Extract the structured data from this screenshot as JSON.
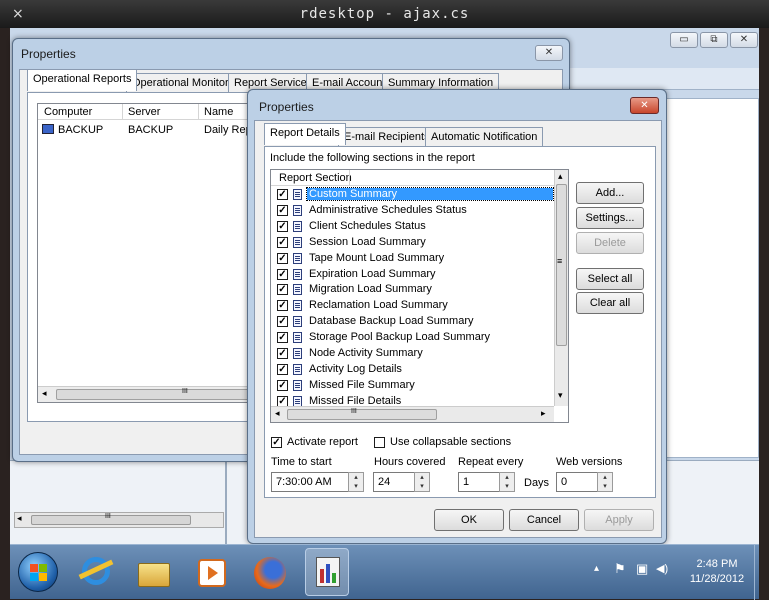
{
  "rdesktop": {
    "title": "rdesktop - ajax.cs",
    "close_glyph": "×"
  },
  "background_app": {
    "minimize": "▭",
    "maximize": "⧉",
    "close": "✕",
    "scroll_left": "◂",
    "scroll_grip": "III"
  },
  "properties_back": {
    "title": "Properties",
    "close": "✕",
    "tabs": [
      "Operational Reports",
      "Operational Monitors",
      "Report Service",
      "E-mail Account",
      "Summary Information"
    ],
    "columns": [
      "Computer",
      "Server",
      "Name"
    ],
    "rows": [
      {
        "computer": "BACKUP",
        "server": "BACKUP",
        "name": "Daily Rep"
      }
    ],
    "scroll_left": "◂",
    "scroll_grip": "III"
  },
  "properties_front": {
    "title": "Properties",
    "close": "✕",
    "tabs": [
      "Report Details",
      "E-mail Recipients",
      "Automatic Notification"
    ],
    "include_label": "Include the following sections in the report",
    "list_header": "Report Section",
    "sections": [
      "Custom Summary",
      "Administrative Schedules Status",
      "Client Schedules Status",
      "Session Load Summary",
      "Tape Mount Load Summary",
      "Expiration Load Summary",
      "Migration Load Summary",
      "Reclamation Load Summary",
      "Database Backup Load Summary",
      "Storage Pool Backup Load Summary",
      "Node Activity Summary",
      "Activity Log Details",
      "Missed File Summary",
      "Missed File Details"
    ],
    "check_mark": "✓",
    "scroll_up": "▴",
    "scroll_down": "▾",
    "scroll_left": "◂",
    "scroll_right": "▸",
    "scroll_grip_v": "≡",
    "scroll_grip_h": "III",
    "buttons": {
      "add": "Add...",
      "settings": "Settings...",
      "delete": "Delete",
      "select_all": "Select all",
      "clear_all": "Clear all"
    },
    "activate_report_label": "Activate report",
    "activate_report_checked": true,
    "collapsable_label": "Use collapsable sections",
    "collapsable_checked": false,
    "time_to_start_label": "Time to start",
    "time_to_start_value": "7:30:00 AM",
    "hours_covered_label": "Hours covered",
    "hours_covered_value": "24",
    "repeat_every_label": "Repeat every",
    "repeat_every_value": "1",
    "days_label": "Days",
    "web_versions_label": "Web versions",
    "web_versions_value": "0",
    "spin_up": "▴",
    "spin_down": "▾",
    "ok": "OK",
    "cancel": "Cancel",
    "apply": "Apply"
  },
  "taskbar": {
    "time": "2:48 PM",
    "date": "11/28/2012",
    "tray_icons": [
      "▴",
      "⚑",
      "▣",
      "◀)"
    ]
  },
  "colors": {
    "selection": "#3399ff",
    "dialog_frame": "#bcd0e6",
    "taskbar": "#40648f"
  }
}
